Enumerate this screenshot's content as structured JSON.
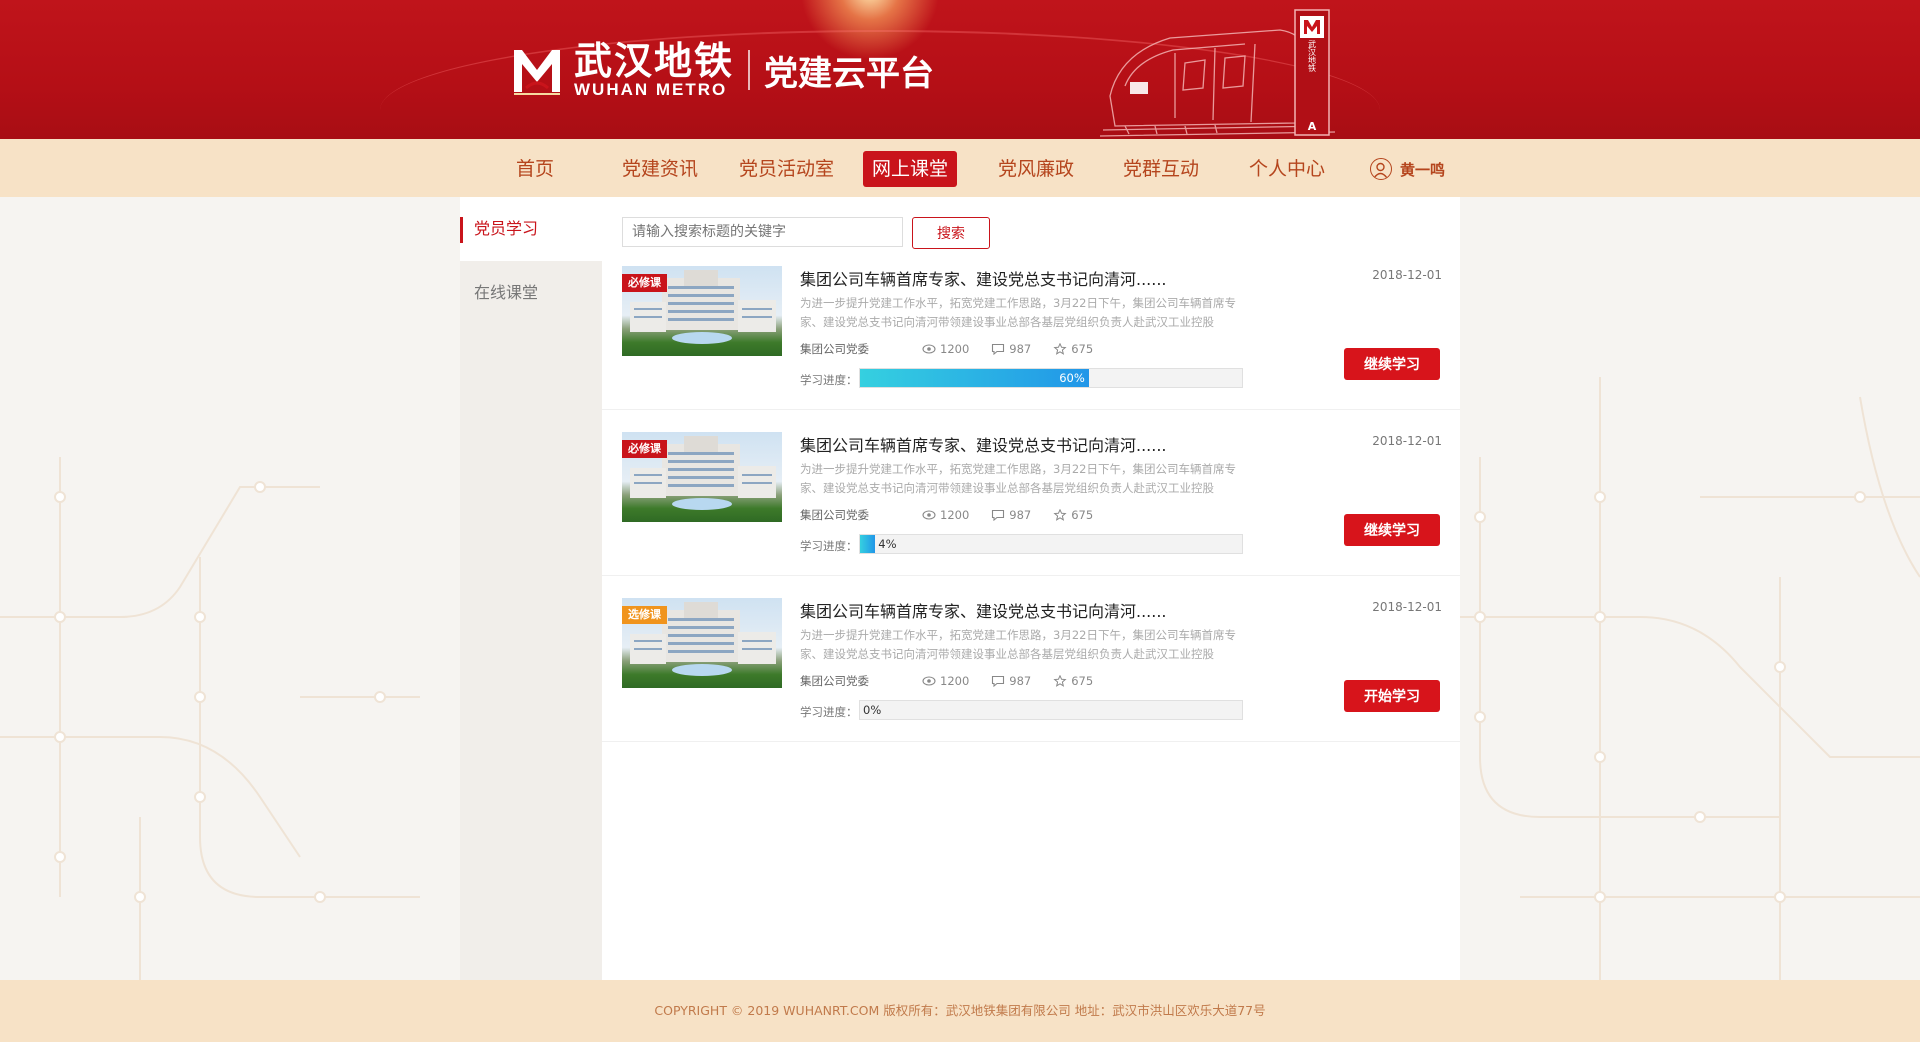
{
  "header": {
    "logo_cn": "武汉地铁",
    "logo_en": "WUHAN METRO",
    "subtitle": "党建云平台",
    "sign_text": "武汉地铁",
    "sign_letter": "A"
  },
  "nav": {
    "items": [
      {
        "label": "首页",
        "active": false
      },
      {
        "label": "党建资讯",
        "active": false
      },
      {
        "label": "党员活动室",
        "active": false
      },
      {
        "label": "网上课堂",
        "active": true
      },
      {
        "label": "党风廉政",
        "active": false
      },
      {
        "label": "党群互动",
        "active": false
      },
      {
        "label": "个人中心",
        "active": false
      }
    ],
    "user_name": "黄一鸣"
  },
  "sidebar": {
    "items": [
      {
        "label": "党员学习",
        "active": true
      },
      {
        "label": "在线课堂",
        "active": false
      }
    ]
  },
  "search": {
    "placeholder": "请输入搜索标题的关键字",
    "button_label": "搜索"
  },
  "courses": [
    {
      "tag": "必修课",
      "tag_type": "required",
      "title": "集团公司车辆首席专家、建设党总支书记向清河......",
      "date": "2018-12-01",
      "desc": "为进一步提升党建工作水平，拓宽党建工作思路，3月22日下午，集团公司车辆首席专家、建设党总支书记向清河带领建设事业总部各基层党组织负责人赴武汉工业控股",
      "org": "集团公司党委",
      "views": "1200",
      "comments": "987",
      "stars": "675",
      "progress_label": "学习进度：",
      "progress": 60,
      "progress_text": "60%",
      "button": "继续学习"
    },
    {
      "tag": "必修课",
      "tag_type": "required",
      "title": "集团公司车辆首席专家、建设党总支书记向清河......",
      "date": "2018-12-01",
      "desc": "为进一步提升党建工作水平，拓宽党建工作思路，3月22日下午，集团公司车辆首席专家、建设党总支书记向清河带领建设事业总部各基层党组织负责人赴武汉工业控股",
      "org": "集团公司党委",
      "views": "1200",
      "comments": "987",
      "stars": "675",
      "progress_label": "学习进度：",
      "progress": 4,
      "progress_text": "4%",
      "button": "继续学习"
    },
    {
      "tag": "选修课",
      "tag_type": "optional",
      "title": "集团公司车辆首席专家、建设党总支书记向清河......",
      "date": "2018-12-01",
      "desc": "为进一步提升党建工作水平，拓宽党建工作思路，3月22日下午，集团公司车辆首席专家、建设党总支书记向清河带领建设事业总部各基层党组织负责人赴武汉工业控股",
      "org": "集团公司党委",
      "views": "1200",
      "comments": "987",
      "stars": "675",
      "progress_label": "学习进度：",
      "progress": 0,
      "progress_text": "0%",
      "button": "开始学习"
    }
  ],
  "footer": {
    "text": "COPYRIGHT © 2019 WUHANRT.COM   版权所有：武汉地铁集团有限公司  地址：武汉市洪山区欢乐大道77号"
  },
  "colors": {
    "brand_red": "#c9141b",
    "nav_bg": "#f7e2c6",
    "nav_text": "#b5451d",
    "tag_required": "#c9141b",
    "tag_optional": "#f0941d",
    "progress_start": "#35d0e0",
    "progress_end": "#2196e8"
  },
  "icons": [
    "user-icon",
    "eye-icon",
    "comment-icon",
    "star-icon",
    "metro-logo-icon"
  ]
}
